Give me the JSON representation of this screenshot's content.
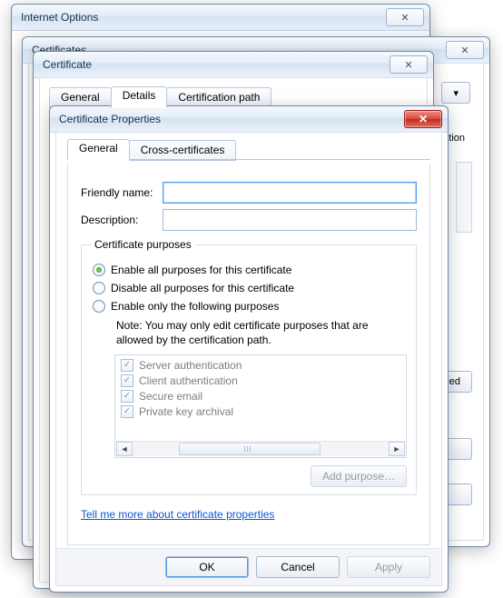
{
  "windows": {
    "internet_options": {
      "title": "Internet Options"
    },
    "certificates": {
      "title": "Certificates"
    },
    "certificate": {
      "title": "Certificate",
      "tabs": {
        "general": "General",
        "details": "Details",
        "certpath": "Certification path"
      }
    },
    "props": {
      "title": "Certificate Properties",
      "tabs": {
        "general": "General",
        "cross": "Cross-certificates"
      },
      "labels": {
        "friendly": "Friendly name:",
        "description": "Description:",
        "groupbox": "Certificate purposes",
        "opt_enable_all": "Enable all purposes for this certificate",
        "opt_disable_all": "Disable all purposes for this certificate",
        "opt_enable_only": "Enable only the following purposes",
        "note": "Note: You may only edit certificate purposes that are allowed by the certification path.",
        "add_purpose": "Add purpose…",
        "help_link": "Tell me more about certificate properties",
        "ok": "OK",
        "cancel": "Cancel",
        "apply": "Apply"
      },
      "values": {
        "friendly": "",
        "description": ""
      },
      "selected_radio": "enable_all",
      "purposes": [
        {
          "label": "Server authentication",
          "checked": true
        },
        {
          "label": "Client authentication",
          "checked": true
        },
        {
          "label": "Secure email",
          "checked": true
        },
        {
          "label": "Private key archival",
          "checked": true
        }
      ]
    }
  },
  "leaked": {
    "fication": "fication",
    "nced": "nced"
  },
  "glyphs": {
    "close_x": "✕",
    "left": "◄",
    "right": "►"
  }
}
